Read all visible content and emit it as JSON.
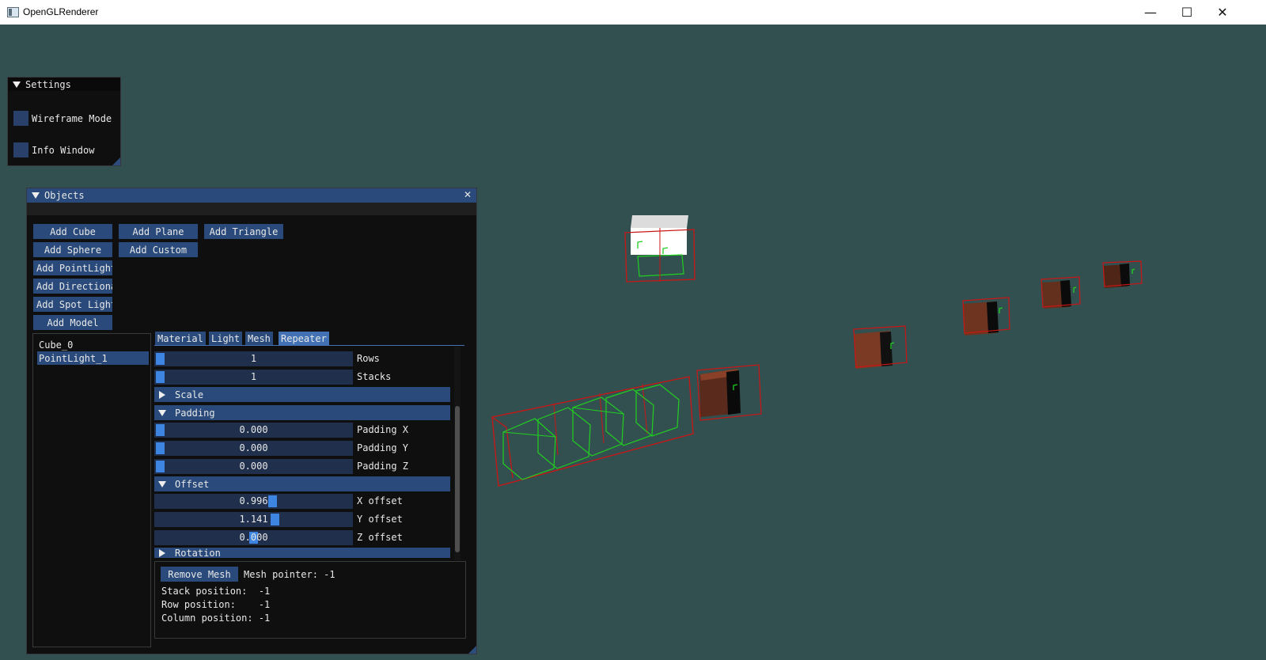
{
  "titlebar": {
    "title": "OpenGLRenderer",
    "minimize": "—",
    "maximize": "☐",
    "close": "✕"
  },
  "settings": {
    "title": "Settings",
    "wireframe_label": "Wireframe Mode",
    "info_label": "Info Window"
  },
  "objects": {
    "title": "Objects",
    "close_glyph": "✕",
    "buttons": {
      "add_cube": "Add Cube",
      "add_plane": "Add Plane",
      "add_triangle": "Add Triangle",
      "add_sphere": "Add Sphere",
      "add_custom": "Add Custom",
      "add_pointlight": "Add PointLight",
      "add_directional": "Add Directional",
      "add_spotlight": "Add Spot Light",
      "add_model": "Add Model"
    },
    "list": [
      "Cube_0",
      "PointLight_1"
    ],
    "tabs": [
      "Material",
      "Light",
      "Mesh",
      "Repeater"
    ],
    "repeater": {
      "rows": {
        "value": "1",
        "label": "Rows"
      },
      "stacks": {
        "value": "1",
        "label": "Stacks"
      },
      "scale_header": "Scale",
      "padding_header": "Padding",
      "padding_x": {
        "value": "0.000",
        "label": "Padding X"
      },
      "padding_y": {
        "value": "0.000",
        "label": "Padding Y"
      },
      "padding_z": {
        "value": "0.000",
        "label": "Padding Z"
      },
      "offset_header": "Offset",
      "x_offset": {
        "value": "0.996",
        "label": "X offset"
      },
      "y_offset": {
        "value": "1.141",
        "label": "Y offset"
      },
      "z_offset": {
        "value": "0.000",
        "label": "Z offset"
      },
      "rotation_header": "Rotation"
    },
    "info": {
      "remove_mesh": "Remove Mesh",
      "mesh_pointer": "Mesh pointer: -1",
      "stack_position": "Stack position:  -1",
      "row_position": "Row position:    -1",
      "column_position": "Column position: -1"
    }
  },
  "colors": {
    "viewport_bg": "#335050",
    "window_bg": "#0f0f0f",
    "button": "#294a7a",
    "active_tab": "#4372b4",
    "slider_grab": "#3d85e0"
  }
}
